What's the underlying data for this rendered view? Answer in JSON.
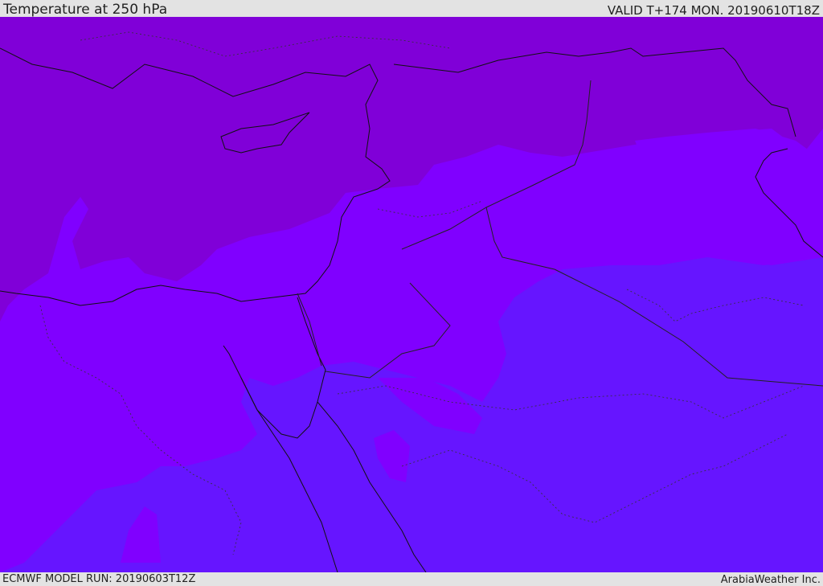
{
  "header": {
    "title": "Temperature at 250 hPa",
    "valid": "VALID T+174 MON. 20190610T18Z"
  },
  "footer": {
    "model_run": "ECMWF MODEL RUN: 20190603T12Z",
    "credit": "ArabiaWeather Inc."
  },
  "map": {
    "field": "temperature",
    "level": "250 hPa",
    "colors": {
      "warm_band": "#8000d8",
      "mid_band": "#8000ff",
      "cool_band": "#6615ff",
      "coastline": "#111111",
      "borders": "#222222"
    }
  }
}
